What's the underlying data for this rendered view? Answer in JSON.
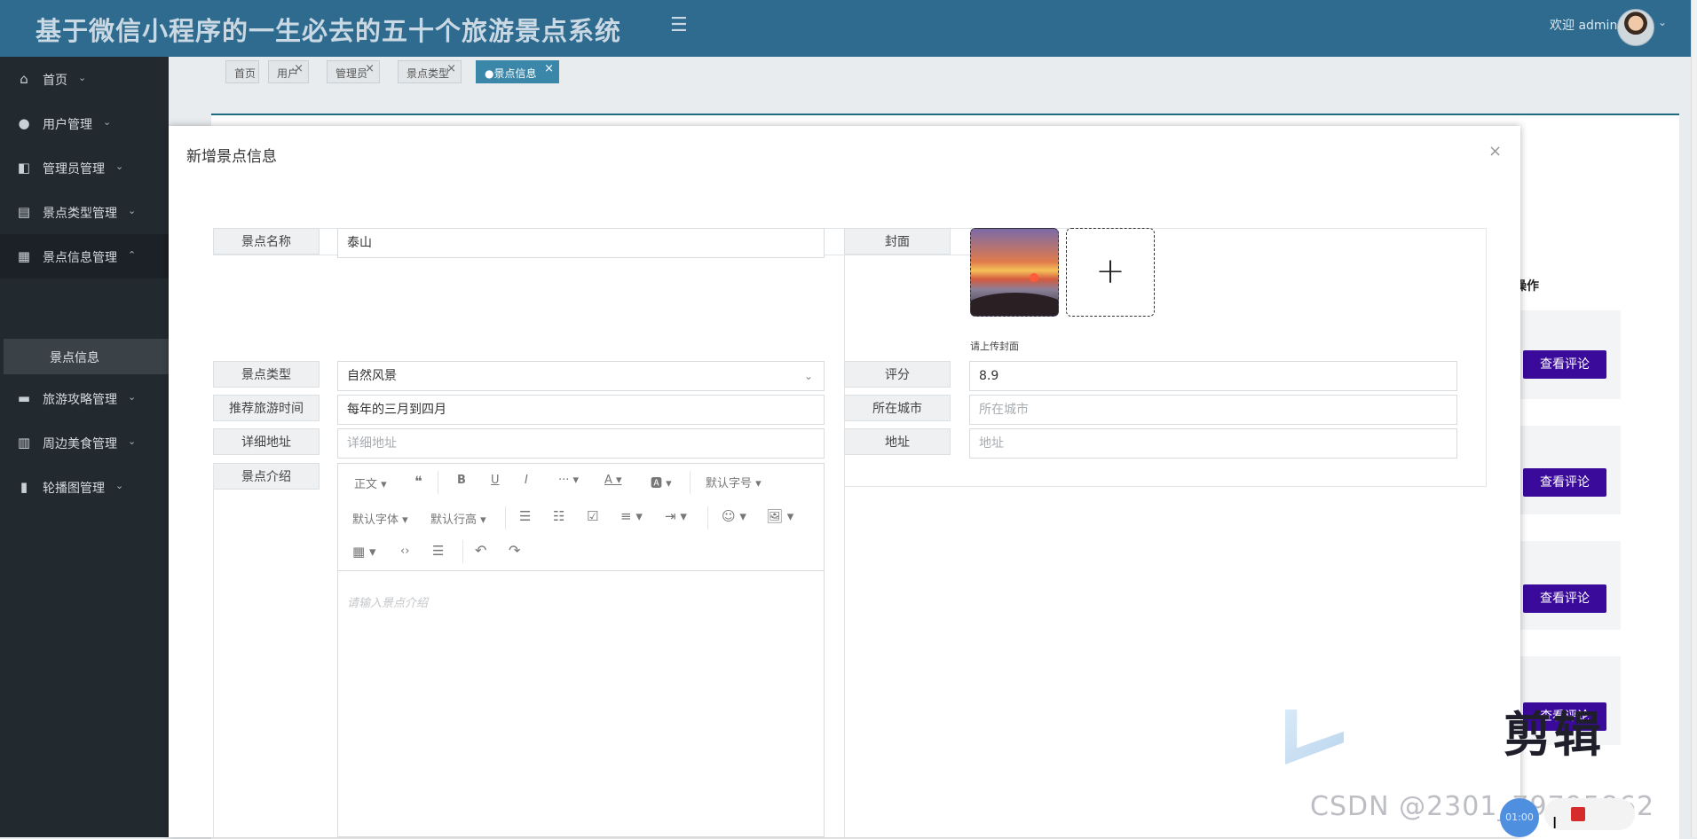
{
  "app": {
    "title": "基于微信小程序的一生必去的五十个旅游景点系统",
    "welcome": "欢迎 admin"
  },
  "sidebar": {
    "items": [
      {
        "label": "首页",
        "icon": "home-icon"
      },
      {
        "label": "用户管理",
        "icon": "user-icon"
      },
      {
        "label": "管理员管理",
        "icon": "admin-icon"
      },
      {
        "label": "景点类型管理",
        "icon": "layout-icon"
      },
      {
        "label": "景点信息管理",
        "icon": "dashboard-icon"
      },
      {
        "label": "旅游攻略管理",
        "icon": "book-icon"
      },
      {
        "label": "周边美食管理",
        "icon": "table-icon"
      },
      {
        "label": "轮播图管理",
        "icon": "bookmark-icon"
      }
    ],
    "submenu": {
      "label": "景点信息"
    }
  },
  "tabs": [
    {
      "label": "首页"
    },
    {
      "label": "用户"
    },
    {
      "label": "管理员"
    },
    {
      "label": "景点类型"
    },
    {
      "label": "●景点信息"
    }
  ],
  "background": {
    "ops_header": "操作",
    "view_comment": "查看评论"
  },
  "modal": {
    "title": "新增景点信息",
    "close": "×",
    "form": {
      "name_label": "景点名称",
      "name_value": "泰山",
      "cover_label": "封面",
      "cover_hint": "请上传封面",
      "type_label": "景点类型",
      "type_value": "自然风景",
      "rating_label": "评分",
      "rating_value": "8.9",
      "season_label": "推荐旅游时间",
      "season_value": "每年的三月到四月",
      "city_label": "所在城市",
      "city_placeholder": "所在城市",
      "detail_address_label": "详细地址",
      "detail_address_placeholder": "详细地址",
      "address_label": "地址",
      "address_placeholder": "地址",
      "intro_label": "景点介绍",
      "intro_placeholder": "请输入景点介绍"
    },
    "editor_toolbar": {
      "paragraph": "正文",
      "font_size": "默认字号",
      "font_family": "默认字体",
      "line_height": "默认行高"
    }
  },
  "watermark": {
    "csdn": "CSDN @2301_79795862",
    "big_text": "剪辑",
    "timer": "01:00"
  }
}
